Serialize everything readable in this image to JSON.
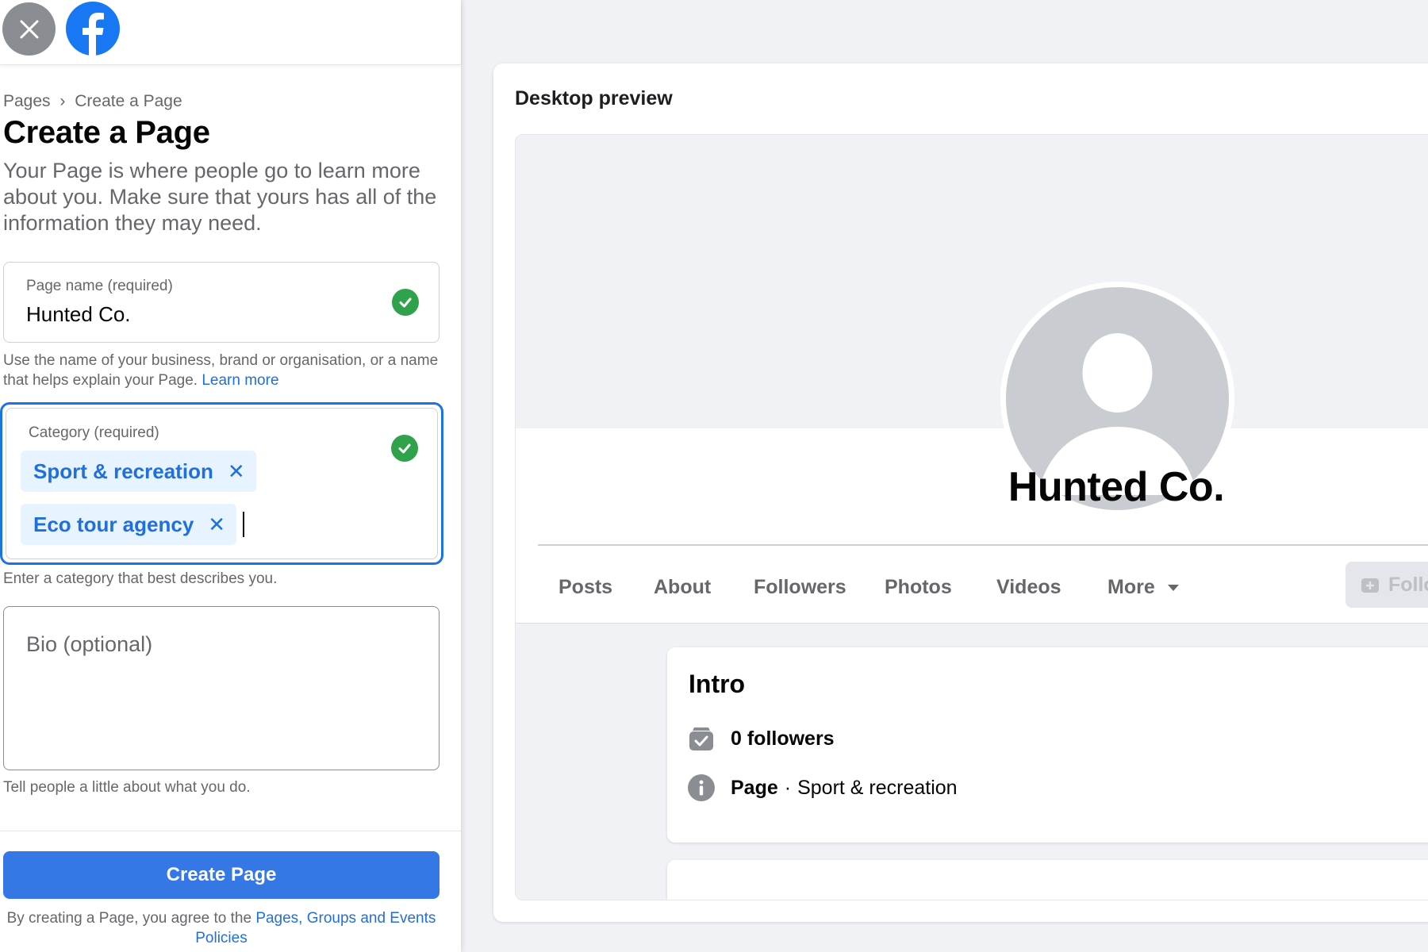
{
  "breadcrumb": [
    "Pages",
    "›",
    "Create a Page"
  ],
  "title": "Create a Page",
  "description": "Your Page is where people go to learn more about you. Make sure that yours has all of the information they may need.",
  "name_field": {
    "label": "Page name (required)",
    "value": "Hunted Co.",
    "helper": "Use the name of your business, brand or organisation, or a name that helps explain your Page.",
    "helper_link": "Learn more"
  },
  "category_field": {
    "label": "Category (required)",
    "chips": [
      "Sport & recreation",
      "Eco tour agency"
    ],
    "remove_glyph": "✕",
    "helper": "Enter a category that best describes you."
  },
  "bio_field": {
    "placeholder": "Bio (optional)",
    "helper": "Tell people a little about what you do."
  },
  "create_button": "Create Page",
  "terms": {
    "text": "By creating a Page, you agree to the",
    "link": "Pages, Groups and Events Policies"
  },
  "preview": {
    "title": "Desktop preview",
    "page_name": "Hunted Co.",
    "tabs": [
      "Posts",
      "About",
      "Followers",
      "Photos",
      "Videos",
      "More"
    ],
    "follow_label": "Follow",
    "intro": {
      "title": "Intro",
      "followers": "0 followers",
      "type_label": "Page",
      "type_sep": "·",
      "category": "Sport & recreation"
    }
  },
  "colors": {
    "accent": "#1b74e4",
    "button": "#3578e5",
    "link": "#216fdb",
    "success": "#31a24c",
    "chip_bg": "#e7f3ff",
    "page_bg": "#f0f2f5"
  },
  "icons": {
    "close": "close-icon",
    "logo": "facebook-logo-icon",
    "check": "check-circle-icon",
    "followers": "followers-icon",
    "info": "info-icon",
    "dropdown": "caret-down-icon"
  }
}
